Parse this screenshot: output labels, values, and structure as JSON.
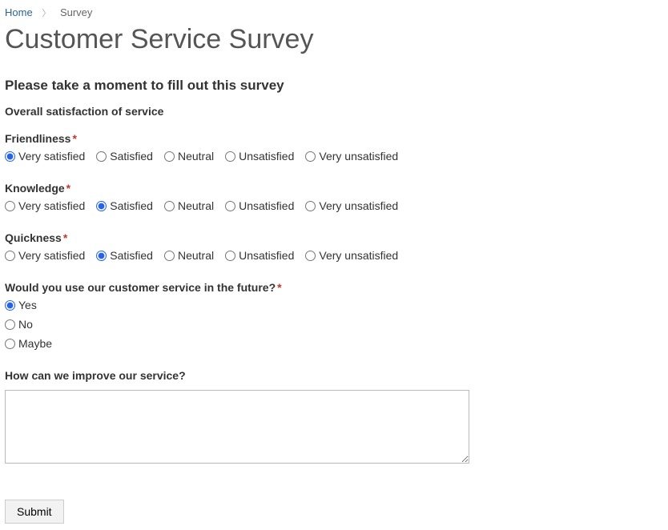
{
  "breadcrumb": {
    "home": "Home",
    "current": "Survey"
  },
  "page_title": "Customer Service Survey",
  "intro": "Please take a moment to fill out this survey",
  "section_heading": "Overall satisfaction of service",
  "scale_options": [
    "Very satisfied",
    "Satisfied",
    "Neutral",
    "Unsatisfied",
    "Very unsatisfied"
  ],
  "questions": {
    "friendliness": {
      "label": "Friendliness",
      "required": true,
      "selected_index": 0
    },
    "knowledge": {
      "label": "Knowledge",
      "required": true,
      "selected_index": 1
    },
    "quickness": {
      "label": "Quickness",
      "required": true,
      "selected_index": 1
    },
    "future": {
      "label": "Would you use our customer service in the future?",
      "required": true,
      "options": [
        "Yes",
        "No",
        "Maybe"
      ],
      "selected_index": 0
    },
    "improve": {
      "label": "How can we improve our service?",
      "value": ""
    }
  },
  "submit_label": "Submit"
}
